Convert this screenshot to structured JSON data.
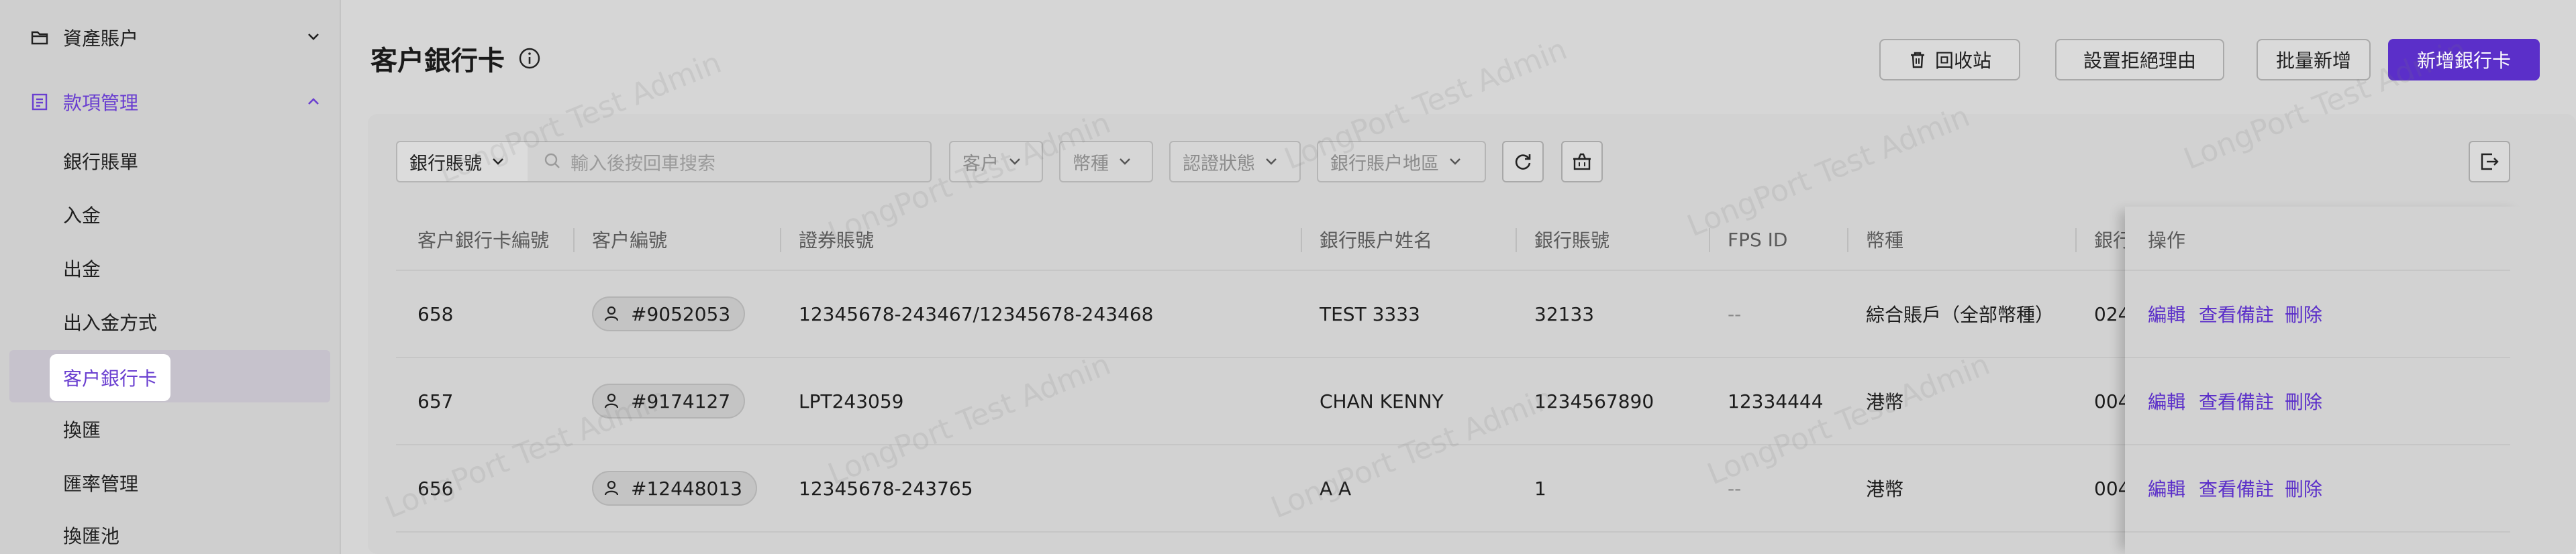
{
  "sidebar": {
    "groups": [
      {
        "label": "資產賬户",
        "icon": "folder-icon"
      },
      {
        "label": "款項管理",
        "icon": "ledger-icon"
      }
    ],
    "items": [
      {
        "label": "銀行賬單"
      },
      {
        "label": "入金"
      },
      {
        "label": "出金"
      },
      {
        "label": "出入金方式"
      },
      {
        "label": "客户銀行卡"
      },
      {
        "label": "換匯"
      },
      {
        "label": "匯率管理"
      },
      {
        "label": "換匯池"
      }
    ]
  },
  "header": {
    "title": "客户銀行卡",
    "buttons": {
      "recycle": "回收站",
      "reject_reason": "設置拒絕理由",
      "batch_add": "批量新增",
      "add_card": "新增銀行卡"
    }
  },
  "filters": {
    "field_select": "銀行賬號",
    "search_placeholder": "輸入後按回車搜索",
    "customer": "客户",
    "currency": "幣種",
    "auth_status": "認證狀態",
    "region": "銀行賬户地區"
  },
  "table": {
    "columns": [
      "客户銀行卡編號",
      "客户編號",
      "證券賬號",
      "銀行賬户姓名",
      "銀行賬號",
      "FPS ID",
      "幣種",
      "銀行",
      "操作"
    ],
    "rows": [
      {
        "id": "658",
        "customer": "#9052053",
        "securities": "12345678-243467/12345678-243468",
        "name": "TEST 3333",
        "bank_no": "32133",
        "fps": "--",
        "currency": "綜合賬戶（全部幣種）",
        "bank": "024"
      },
      {
        "id": "657",
        "customer": "#9174127",
        "securities": "LPT243059",
        "name": "CHAN KENNY",
        "bank_no": "1234567890",
        "fps": "12334444",
        "currency": "港幣",
        "bank": "004"
      },
      {
        "id": "656",
        "customer": "#12448013",
        "securities": "12345678-243765",
        "name": "A A",
        "bank_no": "1",
        "fps": "--",
        "currency": "港幣",
        "bank": "004"
      }
    ],
    "actions": {
      "edit": "編輯",
      "view_note": "查看備註",
      "delete": "刪除"
    }
  },
  "watermark": "LongPort Test Admin",
  "colors": {
    "accent": "#5b2fc9",
    "accent_text": "#6a3fd0"
  }
}
